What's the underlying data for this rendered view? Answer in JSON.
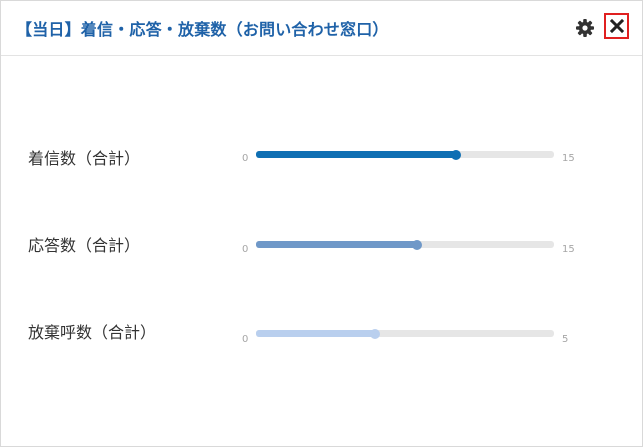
{
  "widget": {
    "title": "【当日】着信・応答・放棄数（お問い合わせ窓口）",
    "icons": {
      "settings": "gear-icon",
      "close": "close-icon"
    },
    "colors": {
      "title": "#1f62a8",
      "close_border": "#e02020",
      "track": "#e6e6e6"
    }
  },
  "rows": [
    {
      "label": "着信数（合計）",
      "min": "0",
      "max": "15",
      "value_fraction": 0.67,
      "color": "#0f6fb3"
    },
    {
      "label": "応答数（合計）",
      "min": "0",
      "max": "15",
      "value_fraction": 0.54,
      "color": "#6f98c8"
    },
    {
      "label": "放棄呼数（合計）",
      "min": "0",
      "max": "5",
      "value_fraction": 0.4,
      "color": "#b9cfee"
    }
  ]
}
